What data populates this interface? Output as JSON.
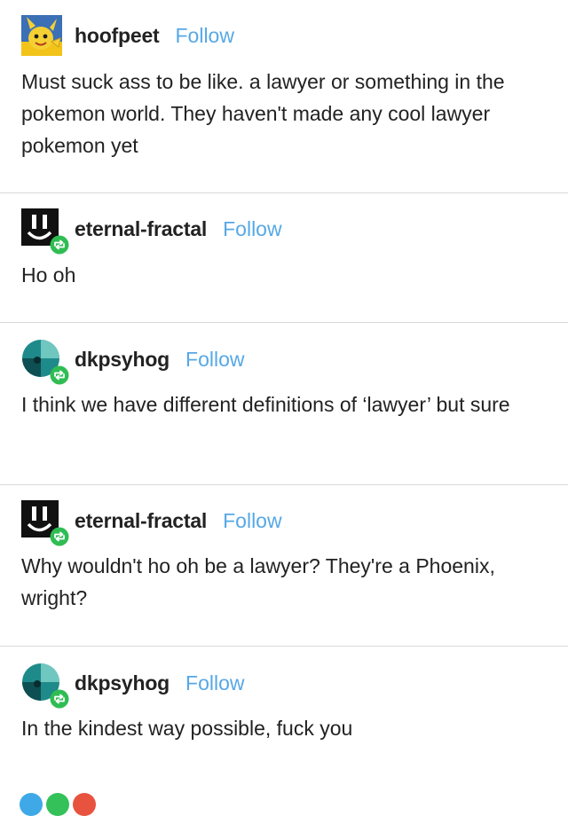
{
  "colors": {
    "follow": "#56a8e6",
    "reblog_badge": "#2fbd53",
    "divider": "#d9d9d9",
    "text": "#222222"
  },
  "posts": [
    {
      "username": "hoofpeet",
      "follow_label": "Follow",
      "avatar_icon": "yellow-cartoon-creature-avatar",
      "text": "Must suck ass to be like. a lawyer or something in the pokemon world. They haven't made any cool lawyer pokemon yet"
    },
    {
      "username": "eternal-fractal",
      "follow_label": "Follow",
      "avatar_icon": "black-smiley-avatar",
      "reblog_icon": "reblog-icon",
      "text": "Ho oh"
    },
    {
      "username": "dkpsyhog",
      "follow_label": "Follow",
      "avatar_icon": "teal-circle-avatar",
      "reblog_icon": "reblog-icon",
      "text": "I think we have different definitions of ‘lawyer’ but sure"
    },
    {
      "username": "eternal-fractal",
      "follow_label": "Follow",
      "avatar_icon": "black-smiley-avatar",
      "reblog_icon": "reblog-icon",
      "text": "Why wouldn't ho oh be a lawyer? They're a Phoenix, wright?"
    },
    {
      "username": "dkpsyhog",
      "follow_label": "Follow",
      "avatar_icon": "teal-circle-avatar",
      "reblog_icon": "reblog-icon",
      "text": "In the kindest way possible, fuck you"
    }
  ],
  "footer": {
    "dot_colors": [
      "#3fa9e8",
      "#34c15a",
      "#e8533f"
    ]
  }
}
